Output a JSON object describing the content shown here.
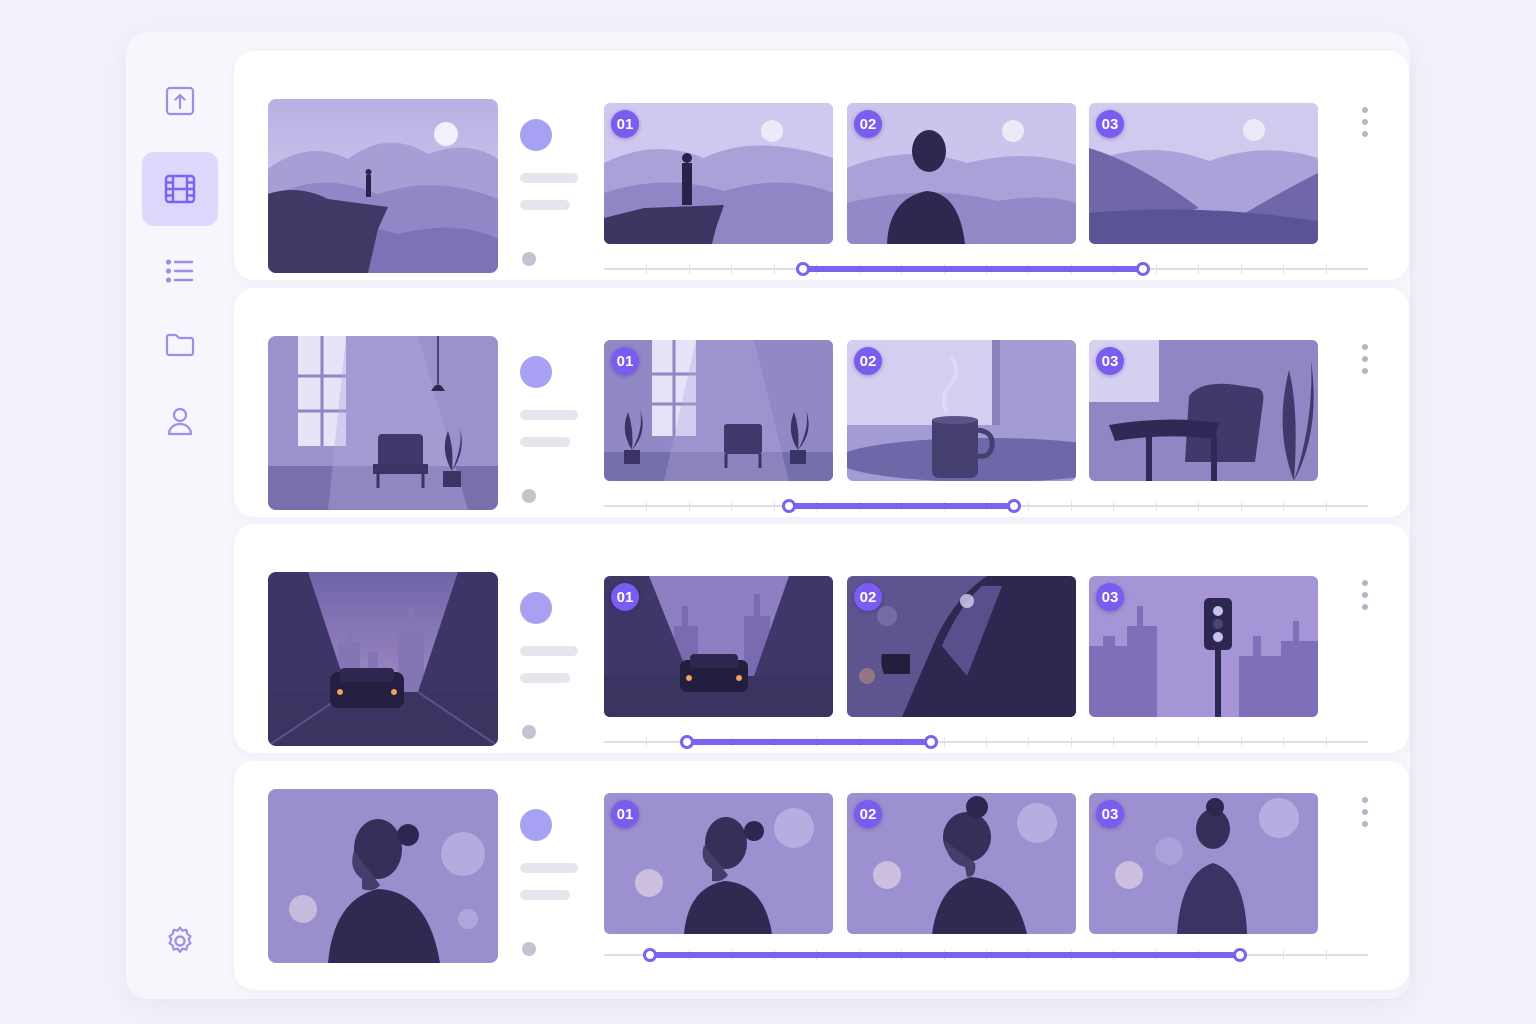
{
  "sidebar": {
    "items": [
      {
        "icon": "upload-frame-icon",
        "active": false
      },
      {
        "icon": "film-icon",
        "active": true
      },
      {
        "icon": "list-icon",
        "active": false
      },
      {
        "icon": "folder-icon",
        "active": false
      },
      {
        "icon": "user-icon",
        "active": false
      }
    ],
    "footer_icon": "settings-gear-icon"
  },
  "colors": {
    "accent": "#7c62ee",
    "accent_soft": "#ddd8fb",
    "badge": "#7a5cf0",
    "avatar": "#a8a0f2"
  },
  "scenes": [
    {
      "scene": "cliff-landscape",
      "shots": [
        {
          "number": "01",
          "subject": "figure-on-cliff"
        },
        {
          "number": "02",
          "subject": "man-portrait-mountains"
        },
        {
          "number": "03",
          "subject": "misty-mountain-valley"
        }
      ],
      "timeline": {
        "start": 0.26,
        "end": 0.705
      }
    },
    {
      "scene": "room-with-armchair",
      "shots": [
        {
          "number": "01",
          "subject": "room-window-plants"
        },
        {
          "number": "02",
          "subject": "steaming-mug"
        },
        {
          "number": "03",
          "subject": "armchair-closeup"
        }
      ],
      "timeline": {
        "start": 0.242,
        "end": 0.537
      }
    },
    {
      "scene": "city-street-car",
      "shots": [
        {
          "number": "01",
          "subject": "car-on-street"
        },
        {
          "number": "02",
          "subject": "car-side-mirror"
        },
        {
          "number": "03",
          "subject": "traffic-light-skyline"
        }
      ],
      "timeline": {
        "start": 0.108,
        "end": 0.428
      }
    },
    {
      "scene": "woman-profile-bokeh",
      "shots": [
        {
          "number": "01",
          "subject": "woman-profile"
        },
        {
          "number": "02",
          "subject": "woman-looking-down"
        },
        {
          "number": "03",
          "subject": "woman-from-behind"
        }
      ],
      "timeline": {
        "start": 0.06,
        "end": 0.833
      }
    }
  ]
}
